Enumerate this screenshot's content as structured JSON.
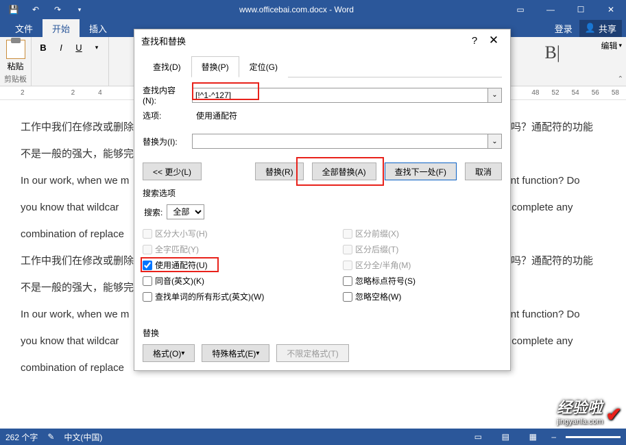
{
  "titlebar": {
    "title": "www.officebai.com.docx - Word"
  },
  "ribbon": {
    "tabs": {
      "file": "文件",
      "home": "开始",
      "insert": "插入"
    },
    "login": "登录",
    "share": "共享",
    "paste": "粘贴",
    "clipboard_label": "剪贴板",
    "bold": "B",
    "italic": "I",
    "underline": "U",
    "edit": "编辑",
    "big_b": "B|"
  },
  "ruler": {
    "left": [
      "2",
      "",
      "2",
      "4"
    ],
    "right": [
      "48",
      "52",
      "54",
      "56",
      "58"
    ]
  },
  "doc": {
    "p1": "工作中我们在修改或删除",
    "p1_end": "吗？通配符的功能",
    "p2": "不是一般的强大，能够完",
    "p3_a": "In our work, when we m",
    "p3_b": "ent function? Do",
    "p4_a": "you know that wildcar",
    "p4_b": "an complete any",
    "p5": "combination of replace",
    "p6": "工作中我们在修改或删除",
    "p6_end": "吗？通配符的功能",
    "p7": "不是一般的强大，能够完",
    "p8_a": "In our work, when we m",
    "p8_b": "ent function? Do",
    "p9_a": "you know that wildcar",
    "p9_b": "an complete any",
    "p10": "combination of replace"
  },
  "dialog": {
    "title": "查找和替换",
    "tabs": {
      "find": "查找(D)",
      "replace": "替换(P)",
      "goto": "定位(G)"
    },
    "find_label": "查找内容(N):",
    "find_value": "[!^1-^127]",
    "options_label": "选项:",
    "options_value": "使用通配符",
    "replace_label": "替换为(I):",
    "replace_value": "",
    "btn_less": "<< 更少(L)",
    "btn_replace": "替换(R)",
    "btn_replace_all": "全部替换(A)",
    "btn_find_next": "查找下一处(F)",
    "btn_cancel": "取消",
    "search_options": "搜索选项",
    "search_label": "搜索:",
    "search_value": "全部",
    "cb_case": "区分大小写(H)",
    "cb_whole": "全字匹配(Y)",
    "cb_wildcard": "使用通配符(U)",
    "cb_sounds": "同音(英文)(K)",
    "cb_forms": "查找单词的所有形式(英文)(W)",
    "cb_prefix": "区分前缀(X)",
    "cb_suffix": "区分后缀(T)",
    "cb_width": "区分全/半角(M)",
    "cb_punct": "忽略标点符号(S)",
    "cb_space": "忽略空格(W)",
    "replace_section": "替换",
    "btn_format": "格式(O)",
    "btn_special": "特殊格式(E)",
    "btn_noformat": "不限定格式(T)"
  },
  "statusbar": {
    "words": "262 个字",
    "lang": "中文(中国)",
    "zoom": ""
  },
  "watermark": {
    "main": "经验啦",
    "sub": "jingyanla.com"
  }
}
